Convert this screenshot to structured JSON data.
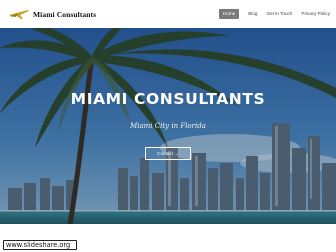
{
  "header": {
    "brand": "Miami Consultants",
    "logo_icon": "airplane-icon",
    "nav": [
      {
        "label": "Home",
        "active": true
      },
      {
        "label": "Blog"
      },
      {
        "label": "Get In Touch"
      },
      {
        "label": "Privacy Policy"
      }
    ]
  },
  "hero": {
    "title": "MIAMI CONSULTANTS",
    "subtitle": "Miami City in Florida",
    "button_label": "Contact →",
    "background": "palm-tree-and-city-skyline-photo"
  },
  "watermark": {
    "text": "www.slideshare.org"
  },
  "colors": {
    "nav_active_bg": "#7a7a7a",
    "sky": "#3b6fb0",
    "water": "#3f8fa0",
    "text": "#111111"
  }
}
